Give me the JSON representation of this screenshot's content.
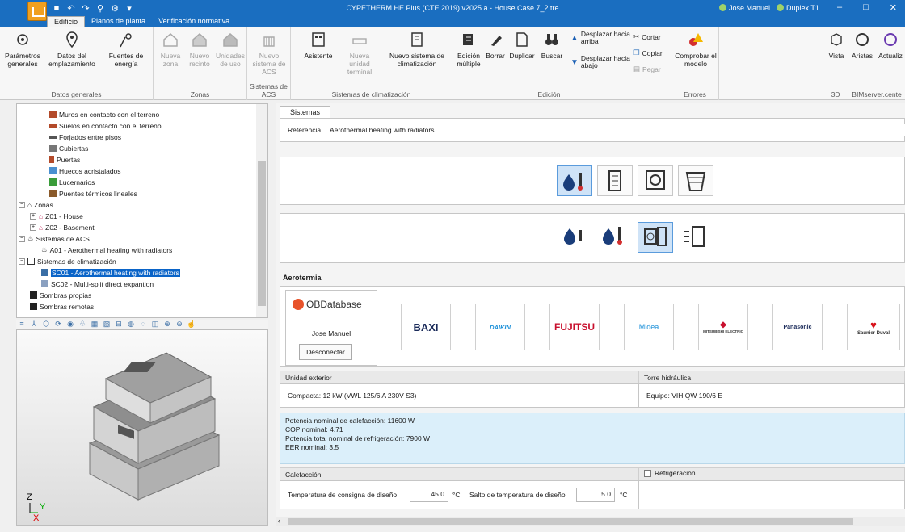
{
  "window": {
    "title": "CYPETHERM HE Plus (CTE 2019) v2025.a - House Case 7_2.tre",
    "user": "Jose Manuel",
    "server": "Duplex T1"
  },
  "tabs": [
    "Edificio",
    "Planos de planta",
    "Verificación normativa"
  ],
  "ribbon": {
    "groups": {
      "datos_generales": "Datos generales",
      "zonas": "Zonas",
      "sistemas_acs": "Sistemas de ACS",
      "sistemas_clim": "Sistemas de climatización",
      "edicion": "Edición",
      "errores": "Errores",
      "view3d": "3D",
      "bim": "BIMserver.cente"
    },
    "buttons": {
      "parametros": "Parámetros generales",
      "datos_emplazamiento": "Datos del emplazamiento",
      "fuentes": "Fuentes de energía",
      "nueva_zona": "Nueva zona",
      "nuevo_recinto": "Nuevo recinto",
      "unidades_uso": "Unidades de uso",
      "nuevo_sistema_acs": "Nuevo sistema de ACS",
      "asistente": "Asistente",
      "nueva_unidad": "Nueva unidad terminal",
      "nuevo_sistema_clim": "Nuevo sistema de climatización",
      "edicion_multiple": "Edición múltiple",
      "borrar": "Borrar",
      "duplicar": "Duplicar",
      "buscar": "Buscar",
      "desplazar_arriba": "Desplazar hacia arriba",
      "desplazar_abajo": "Desplazar hacia abajo",
      "cortar": "Cortar",
      "copiar": "Copiar",
      "pegar": "Pegar",
      "comprobar": "Comprobar el modelo",
      "vista": "Vista",
      "aristas": "Aristas",
      "actualizar": "Actualiz"
    }
  },
  "tree": [
    "Muros en contacto con el terreno",
    "Suelos en contacto con el terreno",
    "Forjados entre pisos",
    "Cubiertas",
    "Puertas",
    "Huecos acristalados",
    "Lucernarios",
    "Puentes térmicos lineales",
    "Zonas",
    "Z01 - House",
    "Z02 - Basement",
    "Sistemas de ACS",
    "A01 - Aerothermal heating with radiators",
    "Sistemas de climatización",
    "SC01 - Aerothermal heating with radiators",
    "SC02 - Multi-split direct expantion",
    "Sombras propias",
    "Sombras remotas"
  ],
  "panel": {
    "tab": "Sistemas",
    "referencia_label": "Referencia",
    "referencia_value": "Aerothermal heating with radiators",
    "section": "Aerotermia",
    "obdb": "OBDatabase",
    "obdb_user": "Jose Manuel",
    "desconectar": "Desconectar",
    "brands": [
      "BAXI",
      "DAIKIN",
      "FUJITSU",
      "Midea",
      "MITSUBISHI ELECTRIC",
      "Panasonic",
      "Saunier Duval"
    ],
    "unidad_exterior_label": "Unidad exterior",
    "unidad_exterior_value": "Compacta: 12 kW (VWL 125/6 A 230V S3)",
    "torre_label": "Torre hidráulica",
    "torre_value": "Equipo: VIH QW 190/6 E",
    "info": [
      "Potencia nominal de calefacción: 11600 W",
      "COP nominal: 4.71",
      "Potencia total nominal de refrigeración: 7900 W",
      "EER nominal: 3.5"
    ],
    "calefaccion_label": "Calefacción",
    "refrigeracion_label": "Refrigeración",
    "temp_consigna_label": "Temperatura de consigna de diseño",
    "temp_consigna_value": "45.0",
    "salto_label": "Salto de temperatura de diseño",
    "salto_value": "5.0",
    "unit_c": "°C"
  },
  "colors": {
    "titlebar": "#1a6ec0",
    "selection": "#0a64c8",
    "active_button": "#cfe3f7",
    "info_bg": "#dbeffa"
  }
}
